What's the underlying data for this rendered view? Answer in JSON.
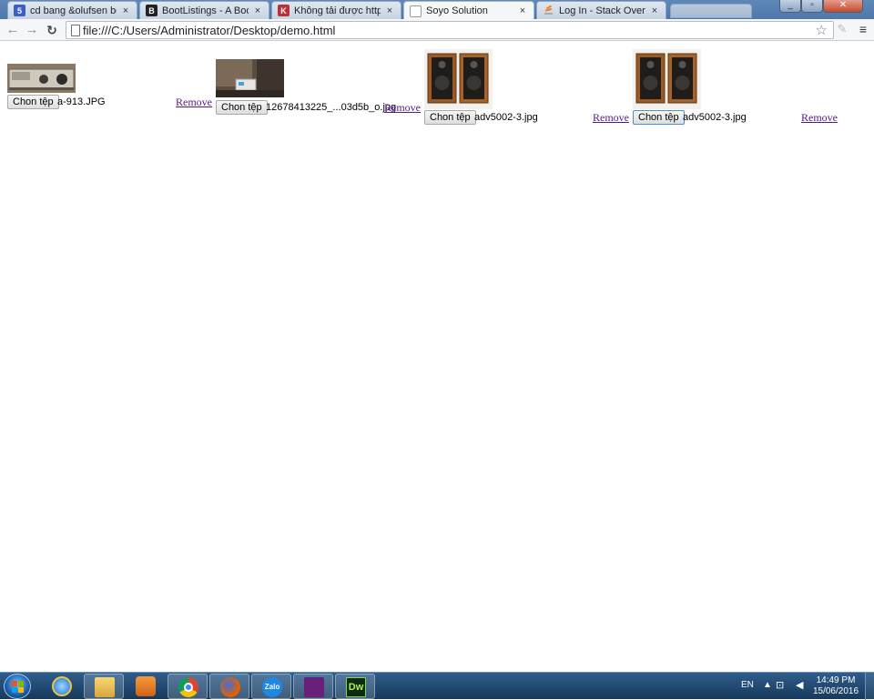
{
  "browser": {
    "tabs": [
      {
        "title": "cd bang &olufsen beogra",
        "favicon": "calendar-icon",
        "favicon_color": "#3b5fc4",
        "favicon_text": "5"
      },
      {
        "title": "BootListings - A Bootstrap",
        "favicon": "bootlistings-icon",
        "favicon_color": "#222222",
        "favicon_text": "B"
      },
      {
        "title": "Không tải được http://giai",
        "favicon": "page-icon",
        "favicon_color": "#b8323a",
        "favicon_text": "K"
      },
      {
        "title": "Soyo Solution",
        "favicon": "blank-page-icon",
        "favicon_color": "#ffffff",
        "favicon_text": "",
        "active": true
      },
      {
        "title": "Log In - Stack Overflow",
        "favicon": "stackoverflow-icon",
        "favicon_color": "#f48024",
        "favicon_text": ""
      }
    ],
    "close_glyph": "×",
    "address": "file:///C:/Users/Administrator/Desktop/demo.html"
  },
  "uploads": [
    {
      "button_label": "Chon tệp",
      "filename": "a-913.JPG",
      "remove_label": "Remove",
      "image": "amplifier"
    },
    {
      "button_label": "Chon tệp",
      "filename": "12678413225_...03d5b_o.jpg",
      "remove_label": "Remove",
      "image": "amplifier-room"
    },
    {
      "button_label": "Chon tệp",
      "filename": "adv5002-3.jpg",
      "remove_label": "Remove",
      "image": "speakers"
    },
    {
      "button_label": "Chon tệp",
      "filename": "adv5002-3.jpg",
      "remove_label": "Remove",
      "image": "speakers"
    }
  ],
  "taskbar": {
    "apps": [
      "internet-explorer-icon",
      "file-explorer-icon",
      "media-player-icon",
      "chrome-icon",
      "firefox-icon",
      "zalo-icon",
      "visual-studio-icon",
      "dreamweaver-icon"
    ],
    "zalo_label": "Zalo",
    "dreamweaver_label": "Dw",
    "language": "EN",
    "time": "14:49 PM",
    "date": "15/06/2016"
  }
}
